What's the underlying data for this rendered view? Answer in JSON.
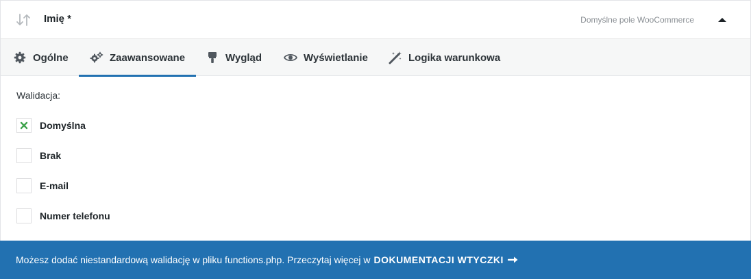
{
  "field": {
    "title": "Imię *",
    "source": "Domyślne pole WooCommerce"
  },
  "tabs": [
    {
      "label": "Ogólne",
      "icon": "gear-icon",
      "active": false
    },
    {
      "label": "Zaawansowane",
      "icon": "gears-icon",
      "active": true
    },
    {
      "label": "Wygląd",
      "icon": "paint-roller-icon",
      "active": false
    },
    {
      "label": "Wyświetlanie",
      "icon": "eye-icon",
      "active": false
    },
    {
      "label": "Logika warunkowa",
      "icon": "magic-wand-icon",
      "active": false
    }
  ],
  "validation": {
    "label": "Walidacja:",
    "options": [
      {
        "label": "Domyślna",
        "checked": true
      },
      {
        "label": "Brak",
        "checked": false
      },
      {
        "label": "E-mail",
        "checked": false
      },
      {
        "label": "Numer telefonu",
        "checked": false
      }
    ]
  },
  "notice": {
    "text": "Możesz dodać niestandardową walidację w pliku functions.php. Przeczytaj więcej w",
    "link_label": "DOKUMENTACJI WTYCZKI"
  },
  "colors": {
    "accent": "#2271b1",
    "check": "#3fa34d"
  }
}
